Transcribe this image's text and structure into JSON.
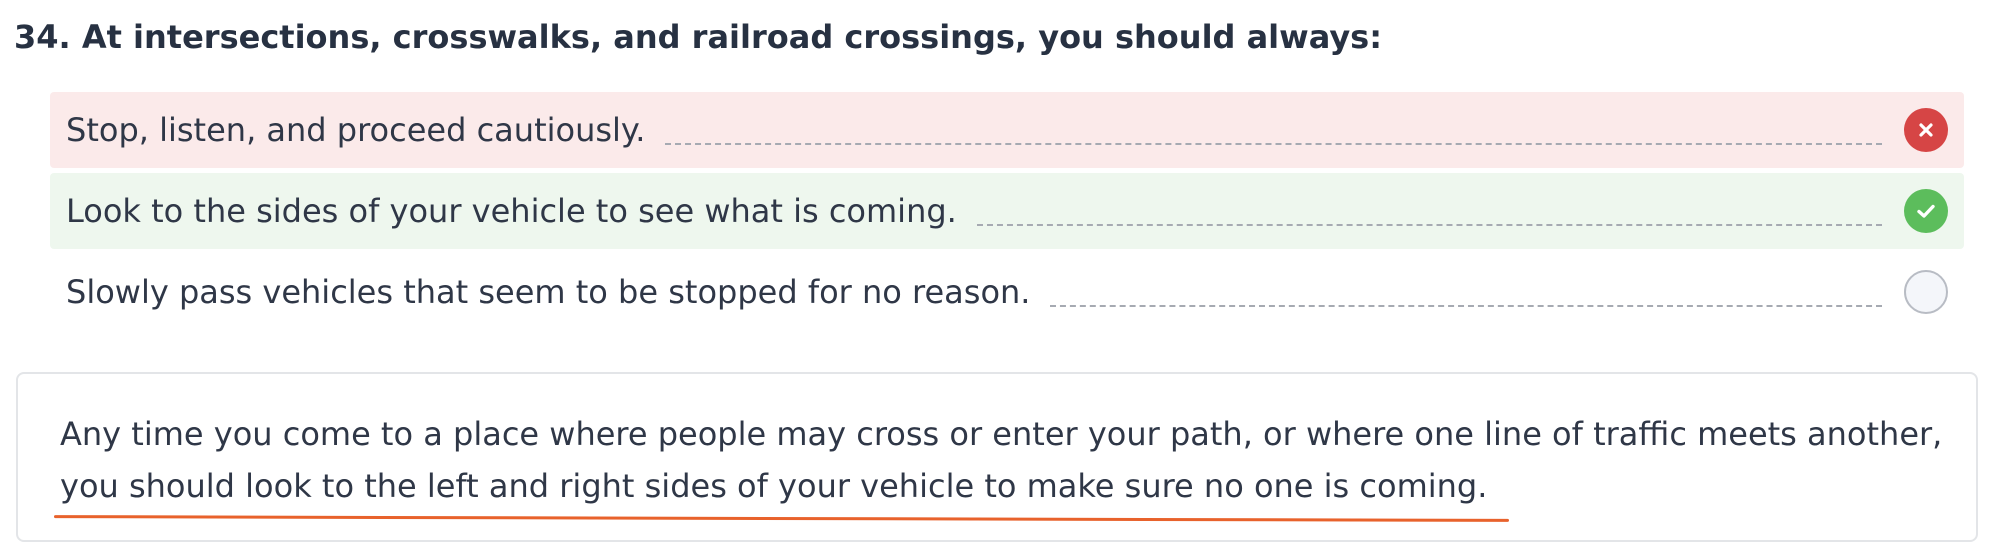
{
  "question": {
    "title": "34. At intersections, crosswalks, and railroad crossings, you should always:"
  },
  "answers": [
    {
      "text": "Stop, listen, and proceed cautiously.",
      "status": "incorrect",
      "icon": "x-icon"
    },
    {
      "text": "Look to the sides of your vehicle to see what is coming.",
      "status": "correct",
      "icon": "check-icon"
    },
    {
      "text": "Slowly pass vehicles that seem to be stopped for no reason.",
      "status": "unselected",
      "icon": "empty-circle-icon"
    }
  ],
  "explanation": {
    "line1": "Any time you come to a place where people may cross or enter your path, or where one line of traffic meets another,",
    "line2": "you should look to the left and right sides of your vehicle to make sure no one is coming."
  },
  "colors": {
    "incorrect_bg": "#fbeaea",
    "correct_bg": "#eef7ee",
    "incorrect_icon": "#d64545",
    "correct_icon": "#5cbd5c",
    "underline": "#e8622c"
  }
}
